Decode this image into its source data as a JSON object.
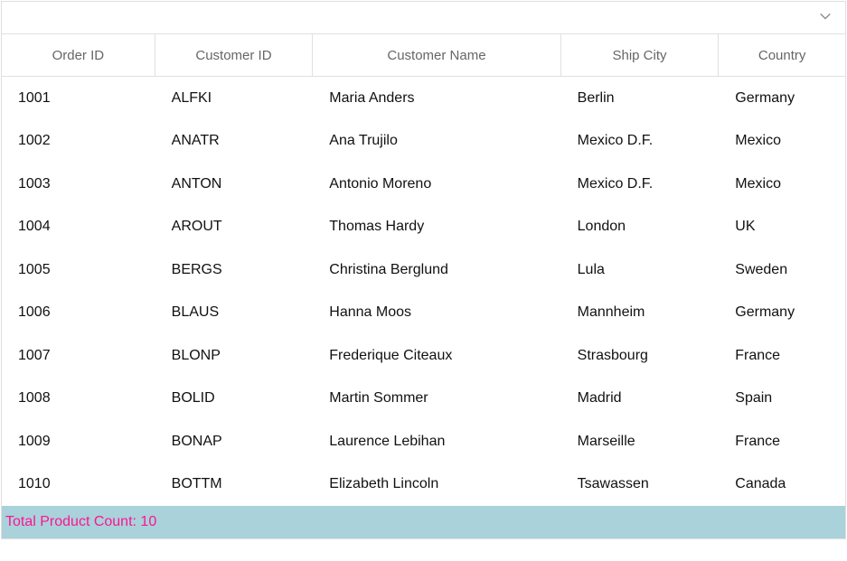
{
  "columns": [
    {
      "key": "orderId",
      "label": "Order ID",
      "cssClass": "col-orderid"
    },
    {
      "key": "customerId",
      "label": "Customer ID",
      "cssClass": "col-customerid"
    },
    {
      "key": "customerName",
      "label": "Customer Name",
      "cssClass": "col-customername"
    },
    {
      "key": "shipCity",
      "label": "Ship City",
      "cssClass": "col-shipcity"
    },
    {
      "key": "country",
      "label": "Country",
      "cssClass": "col-country"
    }
  ],
  "rows": [
    {
      "orderId": "1001",
      "customerId": "ALFKI",
      "customerName": "Maria Anders",
      "shipCity": "Berlin",
      "country": "Germany"
    },
    {
      "orderId": "1002",
      "customerId": "ANATR",
      "customerName": "Ana Trujilo",
      "shipCity": "Mexico D.F.",
      "country": "Mexico"
    },
    {
      "orderId": "1003",
      "customerId": "ANTON",
      "customerName": "Antonio Moreno",
      "shipCity": "Mexico D.F.",
      "country": "Mexico"
    },
    {
      "orderId": "1004",
      "customerId": "AROUT",
      "customerName": "Thomas Hardy",
      "shipCity": "London",
      "country": "UK"
    },
    {
      "orderId": "1005",
      "customerId": "BERGS",
      "customerName": "Christina Berglund",
      "shipCity": "Lula",
      "country": "Sweden"
    },
    {
      "orderId": "1006",
      "customerId": "BLAUS",
      "customerName": "Hanna Moos",
      "shipCity": "Mannheim",
      "country": "Germany"
    },
    {
      "orderId": "1007",
      "customerId": "BLONP",
      "customerName": "Frederique Citeaux",
      "shipCity": "Strasbourg",
      "country": "France"
    },
    {
      "orderId": "1008",
      "customerId": "BOLID",
      "customerName": "Martin Sommer",
      "shipCity": "Madrid",
      "country": "Spain"
    },
    {
      "orderId": "1009",
      "customerId": "BONAP",
      "customerName": "Laurence Lebihan",
      "shipCity": "Marseille",
      "country": "France"
    },
    {
      "orderId": "1010",
      "customerId": "BOTTM",
      "customerName": "Elizabeth Lincoln",
      "shipCity": "Tsawassen",
      "country": "Canada"
    }
  ],
  "footer": {
    "text": "Total Product Count: 10"
  }
}
